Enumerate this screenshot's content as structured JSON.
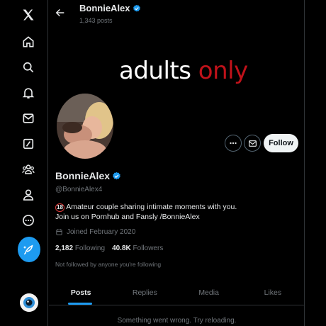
{
  "nav": {
    "items": [
      {
        "name": "x-logo-icon"
      },
      {
        "name": "home-icon"
      },
      {
        "name": "search-icon"
      },
      {
        "name": "notifications-icon"
      },
      {
        "name": "messages-icon"
      },
      {
        "name": "grok-icon"
      },
      {
        "name": "communities-icon"
      },
      {
        "name": "profile-icon"
      },
      {
        "name": "more-icon"
      },
      {
        "name": "compose-post-icon"
      }
    ]
  },
  "header": {
    "name": "BonnieAlex",
    "post_count": "1,343 posts"
  },
  "banner": {
    "word1": "adults",
    "word2": "only"
  },
  "profile": {
    "display_name": "BonnieAlex",
    "handle": "@BonnieAlex4",
    "bio_badge": "18",
    "bio_line1": "Amateur couple sharing intimate moments with you.",
    "bio_line2": "Join us on Pornhub and Fansly /BonnieAlex",
    "joined": "Joined February 2020",
    "following_count": "2,182",
    "following_label": "Following",
    "followers_count": "40.8K",
    "followers_label": "Followers",
    "not_followed": "Not followed by anyone you're following"
  },
  "actions": {
    "follow_label": "Follow"
  },
  "tabs": [
    {
      "label": "Posts",
      "active": true
    },
    {
      "label": "Replies",
      "active": false
    },
    {
      "label": "Media",
      "active": false
    },
    {
      "label": "Likes",
      "active": false
    }
  ],
  "error_message": "Something went wrong. Try reloading.",
  "colors": {
    "accent": "#1d9bf0",
    "banner_red": "#c0121a",
    "muted": "#71767b"
  }
}
